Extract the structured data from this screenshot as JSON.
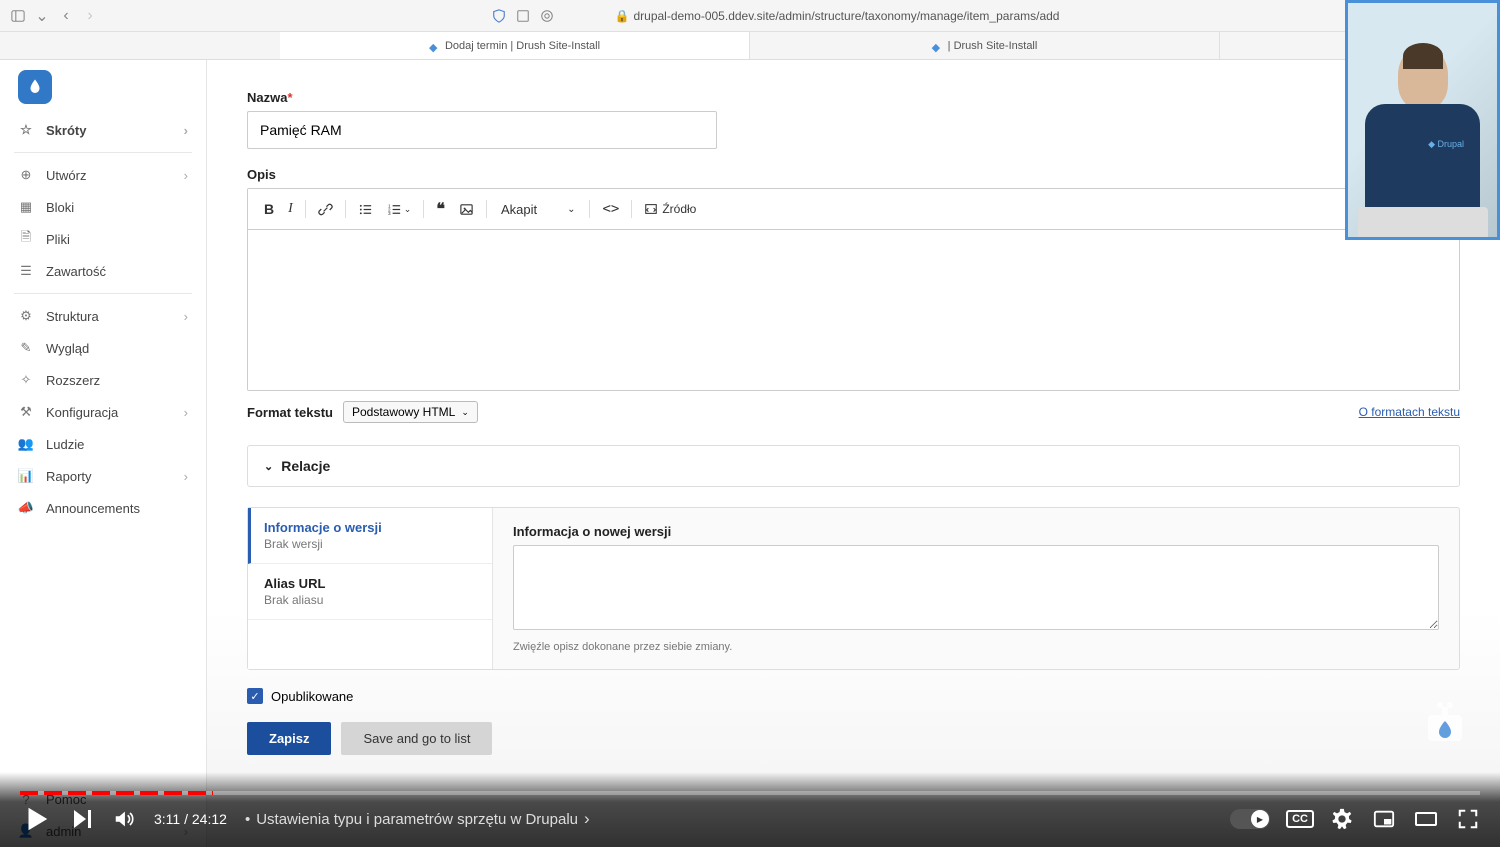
{
  "browser": {
    "url": "drupal-demo-005.ddev.site/admin/structure/taxonomy/manage/item_params/add",
    "tabs": [
      {
        "label": "Dodaj termin | Drush Site-Install",
        "active": true
      },
      {
        "label": "| Drush Site-Install",
        "active": false
      }
    ]
  },
  "sidebar": {
    "items_top": [
      {
        "label": "Skróty",
        "icon": "star",
        "chevron": true,
        "bold": true
      }
    ],
    "items_mid": [
      {
        "label": "Utwórz",
        "icon": "plus-circle",
        "chevron": true
      },
      {
        "label": "Bloki",
        "icon": "blocks",
        "chevron": false
      },
      {
        "label": "Pliki",
        "icon": "file",
        "chevron": false
      },
      {
        "label": "Zawartość",
        "icon": "content",
        "chevron": false
      }
    ],
    "items_admin": [
      {
        "label": "Struktura",
        "icon": "structure",
        "chevron": true
      },
      {
        "label": "Wygląd",
        "icon": "brush",
        "chevron": false
      },
      {
        "label": "Rozszerz",
        "icon": "puzzle",
        "chevron": false
      },
      {
        "label": "Konfiguracja",
        "icon": "sliders",
        "chevron": true
      },
      {
        "label": "Ludzie",
        "icon": "people",
        "chevron": false
      },
      {
        "label": "Raporty",
        "icon": "chart",
        "chevron": true
      },
      {
        "label": "Announcements",
        "icon": "megaphone",
        "chevron": false
      }
    ],
    "items_bottom": [
      {
        "label": "Pomoc",
        "icon": "help",
        "chevron": false
      },
      {
        "label": "admin",
        "icon": "user",
        "chevron": true
      }
    ]
  },
  "form": {
    "name_label": "Nazwa",
    "name_value": "Pamięć RAM",
    "desc_label": "Opis",
    "toolbar": {
      "paragraph": "Akapit",
      "source": "Źródło"
    },
    "format_label": "Format tekstu",
    "format_value": "Podstawowy HTML",
    "format_link": "O formatach tekstu",
    "relations_label": "Relacje",
    "revision": {
      "tab1_title": "Informacje o wersji",
      "tab1_sub": "Brak wersji",
      "tab2_title": "Alias URL",
      "tab2_sub": "Brak aliasu",
      "content_label": "Informacja o nowej wersji",
      "content_help": "Zwięźle opisz dokonane przez siebie zmiany."
    },
    "published_label": "Opublikowane",
    "save_label": "Zapisz",
    "save_list_label": "Save and go to list"
  },
  "video": {
    "current_time": "3:11",
    "total_time": "24:12",
    "chapter": "Ustawienia typu i parametrów sprzętu w Drupalu"
  }
}
